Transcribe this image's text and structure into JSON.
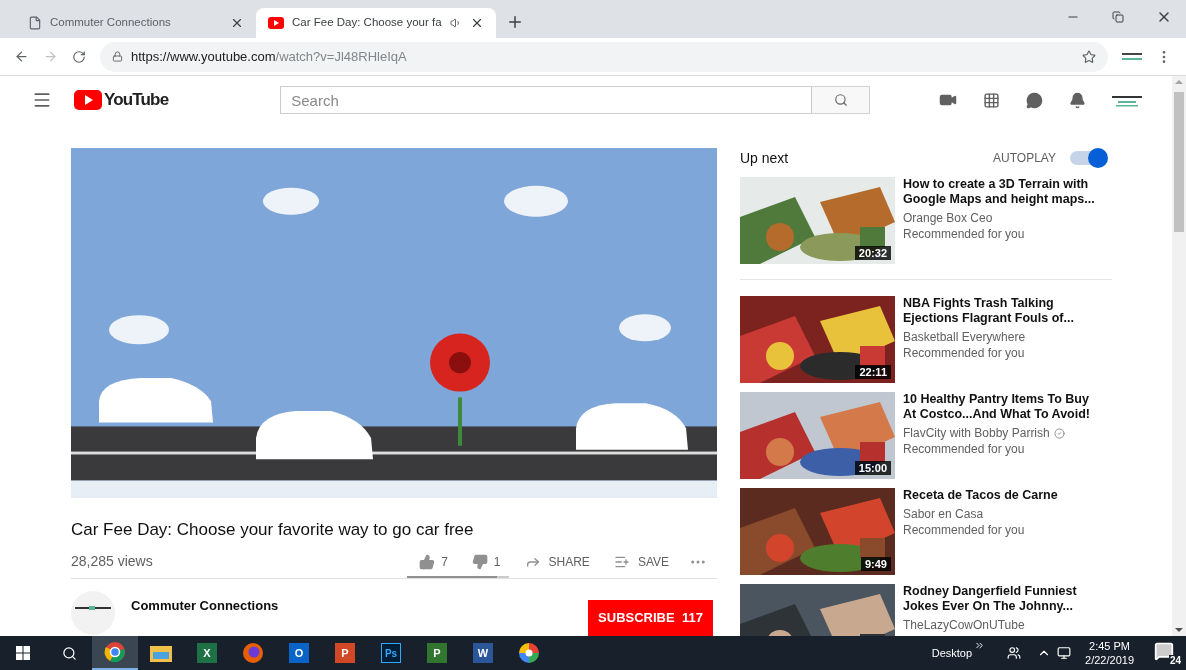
{
  "browser": {
    "tabs": [
      {
        "title": "Commuter Connections",
        "kind": "page",
        "audio": false,
        "selected": false
      },
      {
        "title": "Car Fee Day: Choose your fa",
        "kind": "video",
        "audio": true,
        "selected": true
      }
    ],
    "url_host": "https://www.youtube.com",
    "url_path": "/watch?v=Jl48RHleIqA"
  },
  "header": {
    "logo": "YouTube",
    "search": {
      "placeholder": "Search"
    }
  },
  "video": {
    "title": "Car Fee Day: Choose your favorite way to go car free",
    "views": "28,285 views",
    "likes": "7",
    "dislikes": "1",
    "share": "SHARE",
    "save": "SAVE",
    "level": 0.88
  },
  "channel": {
    "name": "Commuter Connections",
    "subscribe": "SUBSCRIBE  117"
  },
  "up_next": {
    "heading": "Up next",
    "autoplay": {
      "label": "AUTOPLAY",
      "on": true
    },
    "videos": [
      {
        "title": "How to create a 3D Terrain with Google Maps and height maps...",
        "channel": "Orange Box Ceo",
        "verified": false,
        "note": "Recommended for you",
        "duration": "20:32"
      },
      {
        "title": "NBA Fights Trash Talking Ejections Flagrant Fouls of...",
        "channel": "Basketball Everywhere",
        "verified": false,
        "note": "Recommended for you",
        "duration": "22:11"
      },
      {
        "title": "10 Healthy Pantry Items To Buy At Costco...And What To Avoid!",
        "channel": "FlavCity with Bobby Parrish",
        "verified": true,
        "note": "Recommended for you",
        "duration": "15:00"
      },
      {
        "title": "Receta de Tacos de Carne",
        "channel": "Sabor en Casa",
        "verified": false,
        "note": "Recommended for you",
        "duration": "9:49"
      },
      {
        "title": "Rodney Dangerfield Funniest Jokes Ever On The Johnny...",
        "channel": "TheLazyCowOnUTube",
        "verified": false
      }
    ]
  },
  "taskbar": {
    "apps": [
      {
        "kind": "chrome",
        "selected": true
      },
      {
        "kind": "folder",
        "selected": false
      },
      {
        "kind": "tile",
        "letter": "X",
        "color": "#1e7145",
        "selected": false
      },
      {
        "kind": "firefox",
        "selected": false
      },
      {
        "kind": "tile",
        "letter": "O",
        "color": "#0a64c8",
        "selected": false
      },
      {
        "kind": "tile",
        "letter": "P",
        "color": "#d24726",
        "selected": false
      },
      {
        "kind": "outline",
        "letter": "Ps",
        "color": "#31a8ff",
        "selected": false
      },
      {
        "kind": "tile",
        "letter": "P",
        "color": "#31752f",
        "selected": false
      },
      {
        "kind": "tile",
        "letter": "W",
        "color": "#2b579a",
        "selected": false
      },
      {
        "kind": "wheel",
        "selected": false
      }
    ],
    "desktop": "Desktop",
    "time": "2:45 PM",
    "date": "2/22/2019",
    "notifications": "24"
  }
}
